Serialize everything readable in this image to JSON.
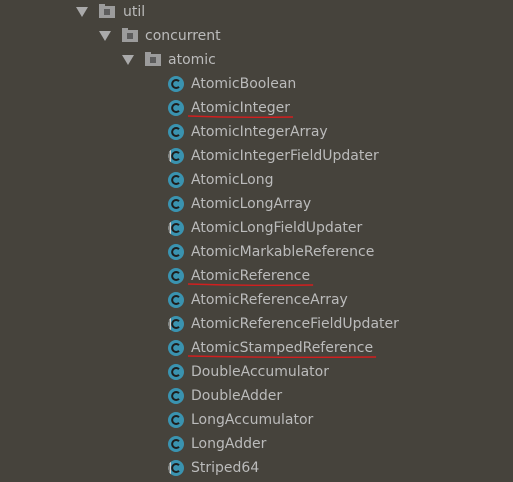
{
  "tree": {
    "packages": [
      {
        "label": "util",
        "icon": "package-icon",
        "expanded": true
      },
      {
        "label": "concurrent",
        "icon": "package-icon",
        "expanded": true
      },
      {
        "label": "atomic",
        "icon": "package-icon",
        "expanded": true
      }
    ],
    "classes": [
      {
        "label": "AtomicBoolean",
        "icon": "class-icon"
      },
      {
        "label": "AtomicInteger",
        "icon": "class-icon",
        "underlined": true
      },
      {
        "label": "AtomicIntegerArray",
        "icon": "class-icon"
      },
      {
        "label": "AtomicIntegerFieldUpdater",
        "icon": "abstract-class-icon"
      },
      {
        "label": "AtomicLong",
        "icon": "class-icon"
      },
      {
        "label": "AtomicLongArray",
        "icon": "class-icon"
      },
      {
        "label": "AtomicLongFieldUpdater",
        "icon": "abstract-class-icon"
      },
      {
        "label": "AtomicMarkableReference",
        "icon": "class-icon"
      },
      {
        "label": "AtomicReference",
        "icon": "class-icon",
        "underlined": true
      },
      {
        "label": "AtomicReferenceArray",
        "icon": "class-icon"
      },
      {
        "label": "AtomicReferenceFieldUpdater",
        "icon": "abstract-class-icon"
      },
      {
        "label": "AtomicStampedReference",
        "icon": "class-icon",
        "underlined": true
      },
      {
        "label": "DoubleAccumulator",
        "icon": "class-icon"
      },
      {
        "label": "DoubleAdder",
        "icon": "class-icon"
      },
      {
        "label": "LongAccumulator",
        "icon": "class-icon"
      },
      {
        "label": "LongAdder",
        "icon": "class-icon"
      },
      {
        "label": "Striped64",
        "icon": "abstract-class-icon"
      }
    ]
  },
  "colors": {
    "background": "#46433c",
    "text": "#bbbbbb",
    "class_icon": "#3a93b0",
    "annotation_underline": "#d11f1f"
  }
}
